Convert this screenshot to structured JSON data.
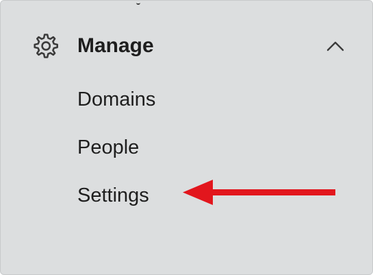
{
  "sidebar": {
    "section": {
      "title": "Manage",
      "icon": "gear-icon",
      "expand_icon": "chevron-up-icon",
      "expanded": true
    },
    "items": [
      {
        "label": "Domains"
      },
      {
        "label": "People"
      },
      {
        "label": "Settings"
      }
    ]
  },
  "annotation": {
    "icon": "red-arrow",
    "color": "#e2161d"
  },
  "colors": {
    "background": "#dcdedf",
    "text": "#1e1e1e",
    "icon": "#3c3c3c"
  }
}
